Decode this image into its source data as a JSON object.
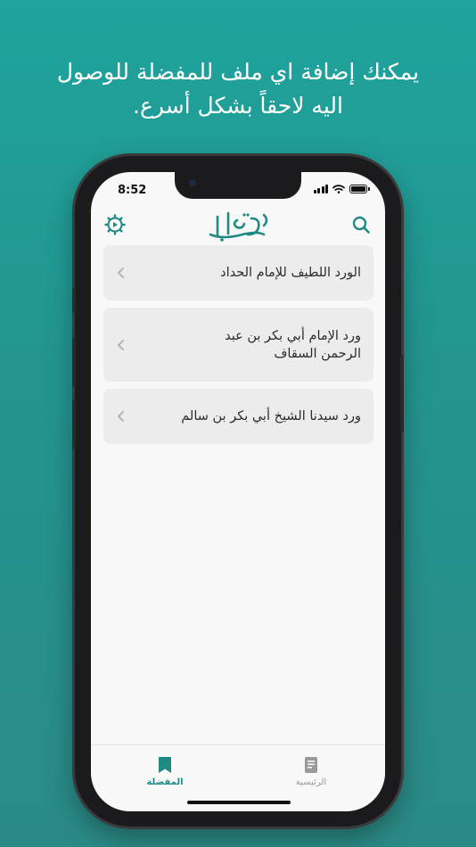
{
  "promo": {
    "line1": "يمكنك إضافة اي ملف للمفضلة للوصول",
    "line2": "اليه لاحقاً بشكل أسرع."
  },
  "status_bar": {
    "time": "8:52"
  },
  "header": {
    "logo_text": "باعلوي",
    "settings_icon": "settings-gear-icon",
    "search_icon": "search-icon"
  },
  "favorites": [
    {
      "title": "الورد اللطيف للإمام الحداد"
    },
    {
      "title": "ورد الإمام أبي بكر بن عبد الرحمن السقاف"
    },
    {
      "title": "ورد سيدنا الشيخ أبي بكر بن سالم"
    }
  ],
  "tabs": [
    {
      "label": "المفضلة",
      "icon": "bookmark-icon",
      "active": true
    },
    {
      "label": "الرئيسية",
      "icon": "book-icon",
      "active": false
    }
  ],
  "colors": {
    "accent": "#1e8a83",
    "background_top": "#1fa39c",
    "background_bottom": "#2b8a86",
    "card": "#ececec",
    "inactive": "#9a9a9a"
  }
}
